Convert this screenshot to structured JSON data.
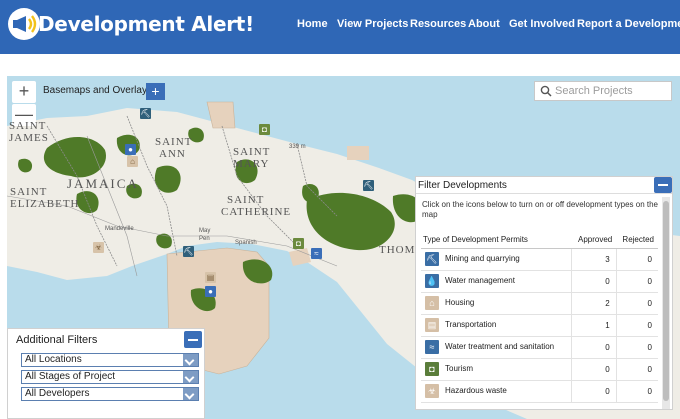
{
  "app": {
    "title": "Development Alert!",
    "brand_color": "#2f67b6"
  },
  "nav": {
    "home": "Home",
    "view_projects": "View Projects",
    "resources": "Resources",
    "about": "About",
    "get_involved": "Get Involved",
    "report": "Report a Development"
  },
  "map": {
    "basemaps_label": "Basemaps and Overlays",
    "basemaps_button": "+",
    "zoom_in": "+",
    "zoom_out": "—",
    "search_placeholder": "Search Projects",
    "labels": {
      "saint_james_1": "SAINT",
      "saint_james_2": "JAMES",
      "saint_ann_1": "SAINT",
      "saint_ann_2": "ANN",
      "saint_mary_1": "SAINT",
      "saint_mary_2": "MARY",
      "jamaica": "JAMAICA",
      "saint_elizabeth_1": "SAINT",
      "saint_elizabeth_2": "ELIZABETH",
      "saint_catherine_1": "SAINT",
      "saint_catherine_2": "CATHERINE",
      "saint_thomas": "THOMAS",
      "mandeville": "Mandeville",
      "may_pen_1": "May",
      "may_pen_2": "Pen",
      "spanish_town": "Spanish",
      "elevation": "339 m"
    }
  },
  "additional_filters": {
    "title": "Additional Filters",
    "locations": "All Locations",
    "stages": "All Stages of Project",
    "developers": "All Developers"
  },
  "filter_developments": {
    "title": "Filter Developments",
    "intro": "Click on the icons below to turn on or off development types on the map",
    "columns": {
      "type": "Type of Development Permits",
      "approved": "Approved",
      "rejected": "Rejected"
    },
    "rows": [
      {
        "name": "Mining and quarrying",
        "approved": "3",
        "rejected": "0",
        "icon": "pickaxe-icon",
        "color": "#3a6ea5",
        "glyph": "⛏"
      },
      {
        "name": "Water management",
        "approved": "0",
        "rejected": "0",
        "icon": "water-drop-icon",
        "color": "#3a6ea5",
        "glyph": "💧"
      },
      {
        "name": "Housing",
        "approved": "2",
        "rejected": "0",
        "icon": "house-icon",
        "color": "#d5bfa6",
        "glyph": "⌂"
      },
      {
        "name": "Transportation",
        "approved": "1",
        "rejected": "0",
        "icon": "bus-icon",
        "color": "#d5bfa6",
        "glyph": "▤"
      },
      {
        "name": "Water treatment and sanitation",
        "approved": "0",
        "rejected": "0",
        "icon": "waves-icon",
        "color": "#3a6ea5",
        "glyph": "≈"
      },
      {
        "name": "Tourism",
        "approved": "0",
        "rejected": "0",
        "icon": "camera-icon",
        "color": "#5a7d3a",
        "glyph": "◘"
      },
      {
        "name": "Hazardous waste",
        "approved": "0",
        "rejected": "0",
        "icon": "biohazard-icon",
        "color": "#d5bfa6",
        "glyph": "☣"
      }
    ]
  }
}
